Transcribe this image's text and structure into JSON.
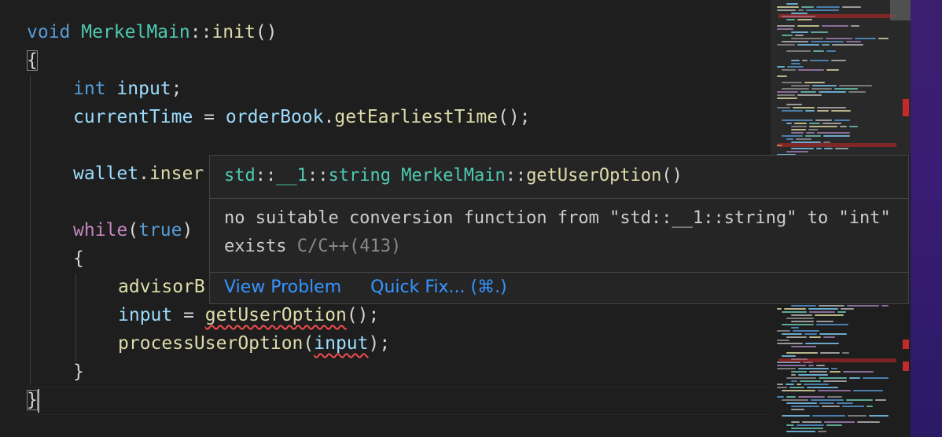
{
  "code": {
    "l1": {
      "kw": "void",
      "cls": "MerkelMain",
      "sep": "::",
      "fn": "init",
      "rest": "()"
    },
    "l2": {
      "brace": "{"
    },
    "l3": {
      "kw": "int",
      "var": "input",
      "rest": ";"
    },
    "l4": {
      "var": "currentTime",
      "op": " = ",
      "obj": "orderBook",
      "dot": ".",
      "fn": "getEarliestTime",
      "rest": "();"
    },
    "l5": {
      "var": "wallet",
      "dot": ".",
      "fn": "inser"
    },
    "l6": {
      "kw": "while",
      "p1": "(",
      "val": "true",
      "p2": ")"
    },
    "l7": {
      "brace": "{"
    },
    "l8": {
      "fn": "advisorB"
    },
    "l9": {
      "var": "input",
      "op": " = ",
      "fn": "getUserOption",
      "rest": "();"
    },
    "l10": {
      "fn": "processUserOption",
      "p1": "(",
      "arg": "input",
      "p2": ");"
    },
    "l11": {
      "brace": "}"
    },
    "l12": {
      "brace": "}"
    }
  },
  "hover": {
    "sig_ns": "std",
    "sig_sep1": "::",
    "sig_ns2": "__1",
    "sig_sep2": "::",
    "sig_type": "string",
    "sig_cls": "MerkelMain",
    "sig_sep3": "::",
    "sig_fn": "getUserOption",
    "sig_rest": "()",
    "message": "no suitable conversion function from \"std::__1::string\" to \"int\" exists",
    "source": "C/C++(413)",
    "actions": {
      "view_problem": "View Problem",
      "quick_fix": "Quick Fix... (⌘.)"
    }
  },
  "colors": {
    "keyword": "#569cd6",
    "control": "#c586c0",
    "type": "#4ec9b0",
    "function": "#dcdcaa",
    "variable": "#9cdcfe",
    "error": "#f14c4c",
    "link": "#3794ff"
  }
}
